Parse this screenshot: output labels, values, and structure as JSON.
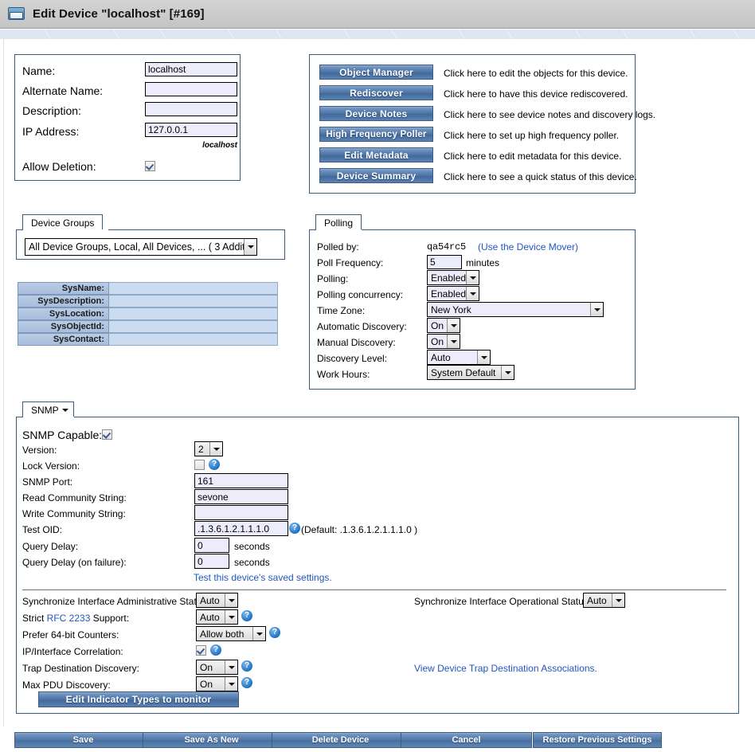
{
  "window": {
    "title": "Edit Device \"localhost\" [#169]",
    "icon": "folder-icon"
  },
  "device_info": {
    "fields": [
      {
        "label": "Name:",
        "value": "localhost"
      },
      {
        "label": "Alternate Name:",
        "value": ""
      },
      {
        "label": "Description:",
        "value": ""
      },
      {
        "label": "IP Address:",
        "value": "127.0.0.1"
      }
    ],
    "resolved_host": "localhost",
    "allow_deletion_label": "Allow Deletion:",
    "allow_deletion_checked": true
  },
  "actions": {
    "rows": [
      {
        "button": "Object Manager",
        "description": "Click here to edit the objects for this device."
      },
      {
        "button": "Rediscover",
        "description": "Click here to have this device rediscovered."
      },
      {
        "button": "Device Notes",
        "description": "Click here to see device notes and discovery logs."
      },
      {
        "button": "High Frequency Poller",
        "description": "Click here to set up high frequency poller."
      },
      {
        "button": "Edit Metadata",
        "description": "Click here to edit metadata for this device."
      },
      {
        "button": "Device Summary",
        "description": "Click here to see a quick status of this device."
      }
    ]
  },
  "device_groups": {
    "tab": "Device Groups",
    "selected": "All Device Groups, Local, All Devices, ... ( 3 Addit"
  },
  "sys_table": {
    "rows": [
      {
        "key": "SysName:",
        "value": ""
      },
      {
        "key": "SysDescription:",
        "value": ""
      },
      {
        "key": "SysLocation:",
        "value": ""
      },
      {
        "key": "SysObjectId:",
        "value": ""
      },
      {
        "key": "SysContact:",
        "value": ""
      }
    ]
  },
  "polling": {
    "tab": "Polling",
    "polled_by_label": "Polled by:",
    "polled_by_value": "qa54rc5",
    "device_mover_link": "(Use the Device Mover)",
    "poll_frequency_label": "Poll Frequency:",
    "poll_frequency_value": "5",
    "poll_frequency_units": "minutes",
    "polling_label": "Polling:",
    "polling_value": "Enabled",
    "concurrency_label": "Polling concurrency:",
    "concurrency_value": "Enabled",
    "timezone_label": "Time Zone:",
    "timezone_value": "New York",
    "auto_discovery_label": "Automatic Discovery:",
    "auto_discovery_value": "On",
    "manual_discovery_label": "Manual Discovery:",
    "manual_discovery_value": "On",
    "discovery_level_label": "Discovery Level:",
    "discovery_level_value": "Auto",
    "work_hours_label": "Work Hours:",
    "work_hours_value": "System Default"
  },
  "snmp": {
    "tab": "SNMP",
    "capable_label": "SNMP Capable:",
    "capable_checked": true,
    "version_label": "Version:",
    "version_value": "2",
    "lock_version_label": "Lock Version:",
    "lock_version_checked": false,
    "port_label": "SNMP Port:",
    "port_value": "161",
    "read_community_label": "Read Community String:",
    "read_community_value": "sevone",
    "write_community_label": "Write Community String:",
    "write_community_value": "",
    "test_oid_label": "Test OID:",
    "test_oid_value": ".1.3.6.1.2.1.1.1.0",
    "test_oid_default": "(Default: .1.3.6.1.2.1.1.1.0 )",
    "query_delay_label": "Query Delay:",
    "query_delay_value": "0",
    "query_delay_units": "seconds",
    "query_delay_fail_label": "Query Delay (on failure):",
    "query_delay_fail_value": "0",
    "query_delay_fail_units": "seconds",
    "test_link": "Test this device's saved settings.",
    "sync_admin_label": "Synchronize Interface Administrative Status:",
    "sync_admin_value": "Auto",
    "sync_oper_label": "Synchronize Interface Operational Status:",
    "sync_oper_value": "Auto",
    "strict_rfc_label_pre": "Strict ",
    "strict_rfc_link": "RFC 2233",
    "strict_rfc_label_post": " Support:",
    "strict_rfc_value": "Auto",
    "counters_label": "Prefer 64-bit Counters:",
    "counters_value": "Allow both",
    "correlation_label": "IP/Interface Correlation:",
    "correlation_checked": true,
    "trap_discovery_label": "Trap Destination Discovery:",
    "trap_discovery_value": "On",
    "max_pdu_label": "Max PDU Discovery:",
    "max_pdu_value": "On",
    "trap_assoc_link": "View Device Trap Destination Associations.",
    "indicator_button": "Edit Indicator Types to monitor"
  },
  "footer": {
    "buttons": [
      "Save",
      "Save As New",
      "Delete Device",
      "Cancel",
      "Restore Previous Settings"
    ]
  },
  "colors": {
    "accent_blue": "#4a72a5",
    "link_blue": "#2157c2",
    "field_bg": "#edecfb",
    "panel_border": "#3c5a80",
    "titlebar": "#cccccc"
  }
}
